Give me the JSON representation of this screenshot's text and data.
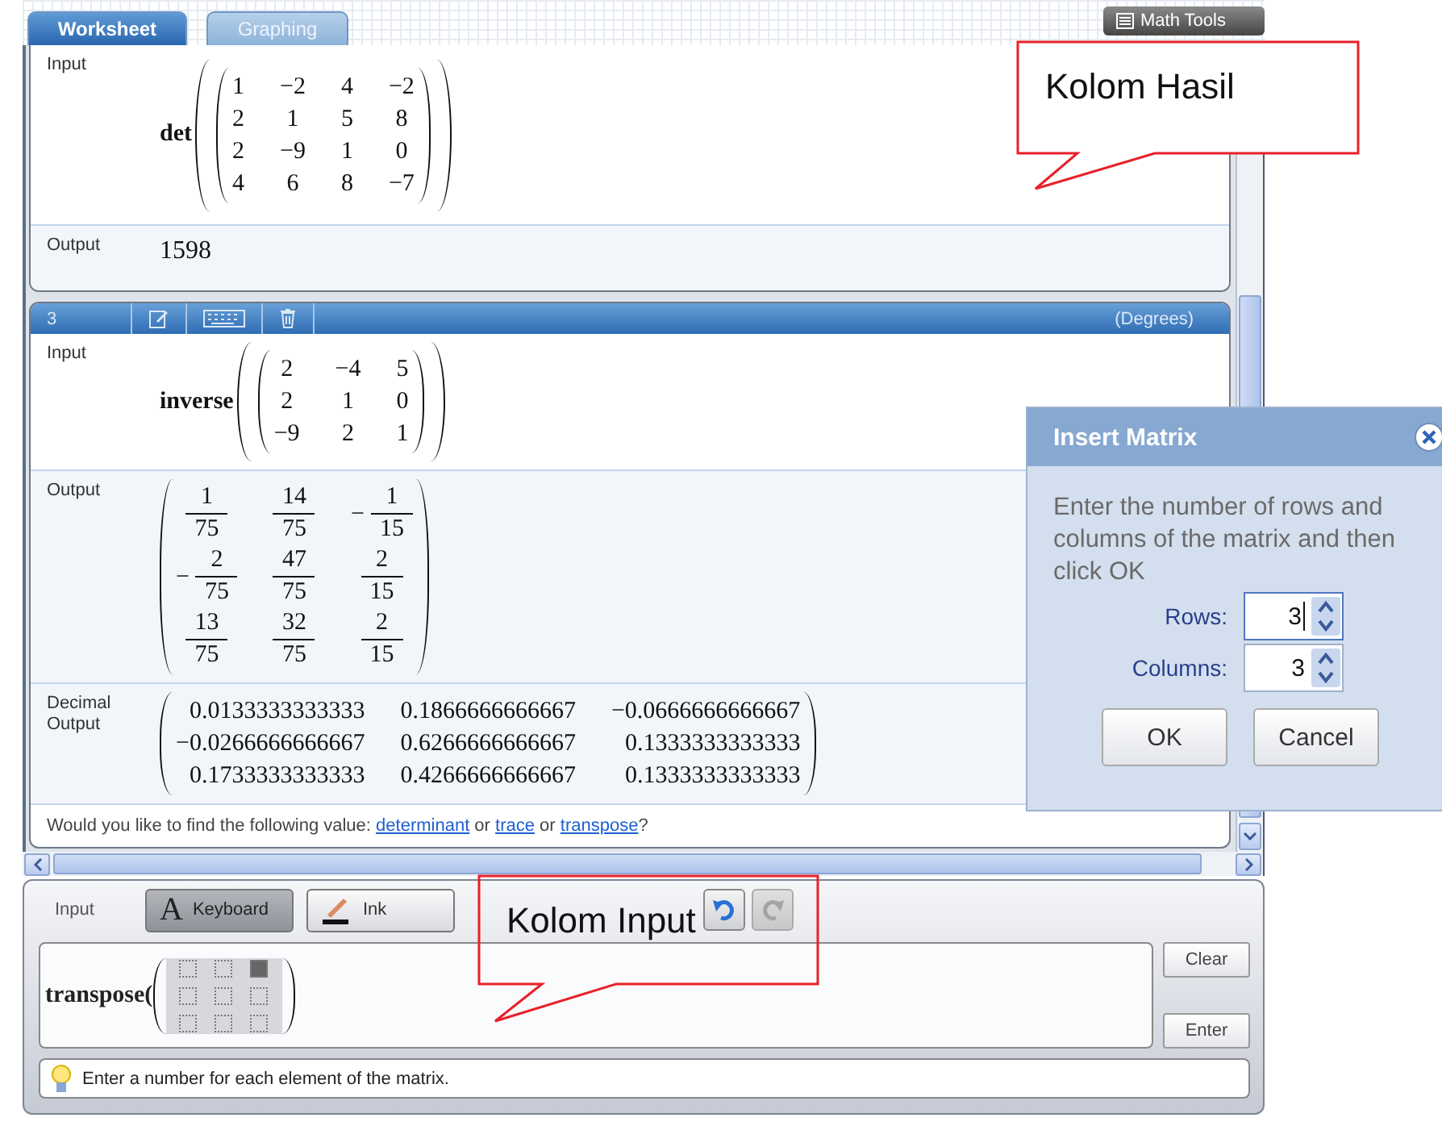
{
  "tabs": [
    {
      "label": "Worksheet",
      "selected": true
    },
    {
      "label": "Graphing",
      "selected": false
    }
  ],
  "math_tools_button": {
    "label": "Math Tools"
  },
  "entries": [
    {
      "rows": [
        {
          "label": "Input",
          "kind": "function",
          "function": "det",
          "matrix": [
            [
              "1",
              "−2",
              "4",
              "−2"
            ],
            [
              "2",
              "1",
              "5",
              "8"
            ],
            [
              "2",
              "−9",
              "1",
              "0"
            ],
            [
              "4",
              "6",
              "8",
              "−7"
            ]
          ]
        },
        {
          "label": "Output",
          "kind": "number",
          "value": "1598"
        }
      ]
    },
    {
      "header": {
        "number": "3",
        "mode": "(Degrees)"
      },
      "rows": [
        {
          "label": "Input",
          "kind": "function",
          "function": "inverse",
          "matrix": [
            [
              "2",
              "−4",
              "5"
            ],
            [
              "2",
              "1",
              "0"
            ],
            [
              "−9",
              "2",
              "1"
            ]
          ]
        },
        {
          "label": "Output",
          "kind": "fractions",
          "matrix": [
            [
              {
                "num": "1",
                "den": "75"
              },
              {
                "num": "14",
                "den": "75"
              },
              {
                "sign": "−",
                "num": "1",
                "den": "15"
              }
            ],
            [
              {
                "sign": "−",
                "num": "2",
                "den": "75"
              },
              {
                "num": "47",
                "den": "75"
              },
              {
                "num": "2",
                "den": "15"
              }
            ],
            [
              {
                "num": "13",
                "den": "75"
              },
              {
                "num": "32",
                "den": "75"
              },
              {
                "num": "2",
                "den": "15"
              }
            ]
          ]
        },
        {
          "label": "Decimal Output",
          "kind": "matrix",
          "matrix": [
            [
              "0.0133333333333",
              "0.1866666666667",
              "−0.0666666666667"
            ],
            [
              "−0.0266666666667",
              "0.6266666666667",
              "0.1333333333333"
            ],
            [
              "0.1733333333333",
              "0.4266666666667",
              "0.1333333333333"
            ]
          ]
        }
      ],
      "suggestion": [
        {
          "kind": "text",
          "text": "Would you like to find the following value: "
        },
        {
          "kind": "link",
          "text": "determinant"
        },
        {
          "kind": "text",
          "text": " or "
        },
        {
          "kind": "link",
          "text": "trace"
        },
        {
          "kind": "text",
          "text": " or "
        },
        {
          "kind": "link",
          "text": "transpose"
        },
        {
          "kind": "text",
          "text": "?"
        }
      ]
    }
  ],
  "input_panel": {
    "label": "Input",
    "modes": [
      {
        "label": "Keyboard",
        "glyph": "A",
        "selected": true
      },
      {
        "label": "Ink",
        "selected": false
      }
    ],
    "history": [
      {
        "kind": "undo",
        "disabled": false
      },
      {
        "kind": "redo",
        "disabled": true
      }
    ],
    "expression": "transpose(",
    "placeholders": [
      [
        {
          "selected": false
        },
        {
          "selected": false
        },
        {
          "selected": true
        }
      ],
      [
        {
          "selected": false
        },
        {
          "selected": false
        },
        {
          "selected": false
        }
      ],
      [
        {
          "selected": false
        },
        {
          "selected": false
        },
        {
          "selected": false
        }
      ]
    ],
    "buttons": [
      {
        "label": "Clear"
      },
      {
        "label": "Enter"
      }
    ],
    "hint": "Enter a number for each element of the matrix."
  },
  "dialog": {
    "title": "Insert Matrix",
    "message": "Enter the number of rows and columns of the matrix and then click OK",
    "fields": [
      {
        "label": "Rows:",
        "value": "3",
        "focused": true
      },
      {
        "label": "Columns:",
        "value": "3",
        "focused": false
      }
    ],
    "buttons": [
      {
        "label": "OK"
      },
      {
        "label": "Cancel"
      }
    ]
  },
  "callouts": [
    {
      "text": "Kolom Hasil"
    },
    {
      "text": "Kolom Input"
    }
  ]
}
